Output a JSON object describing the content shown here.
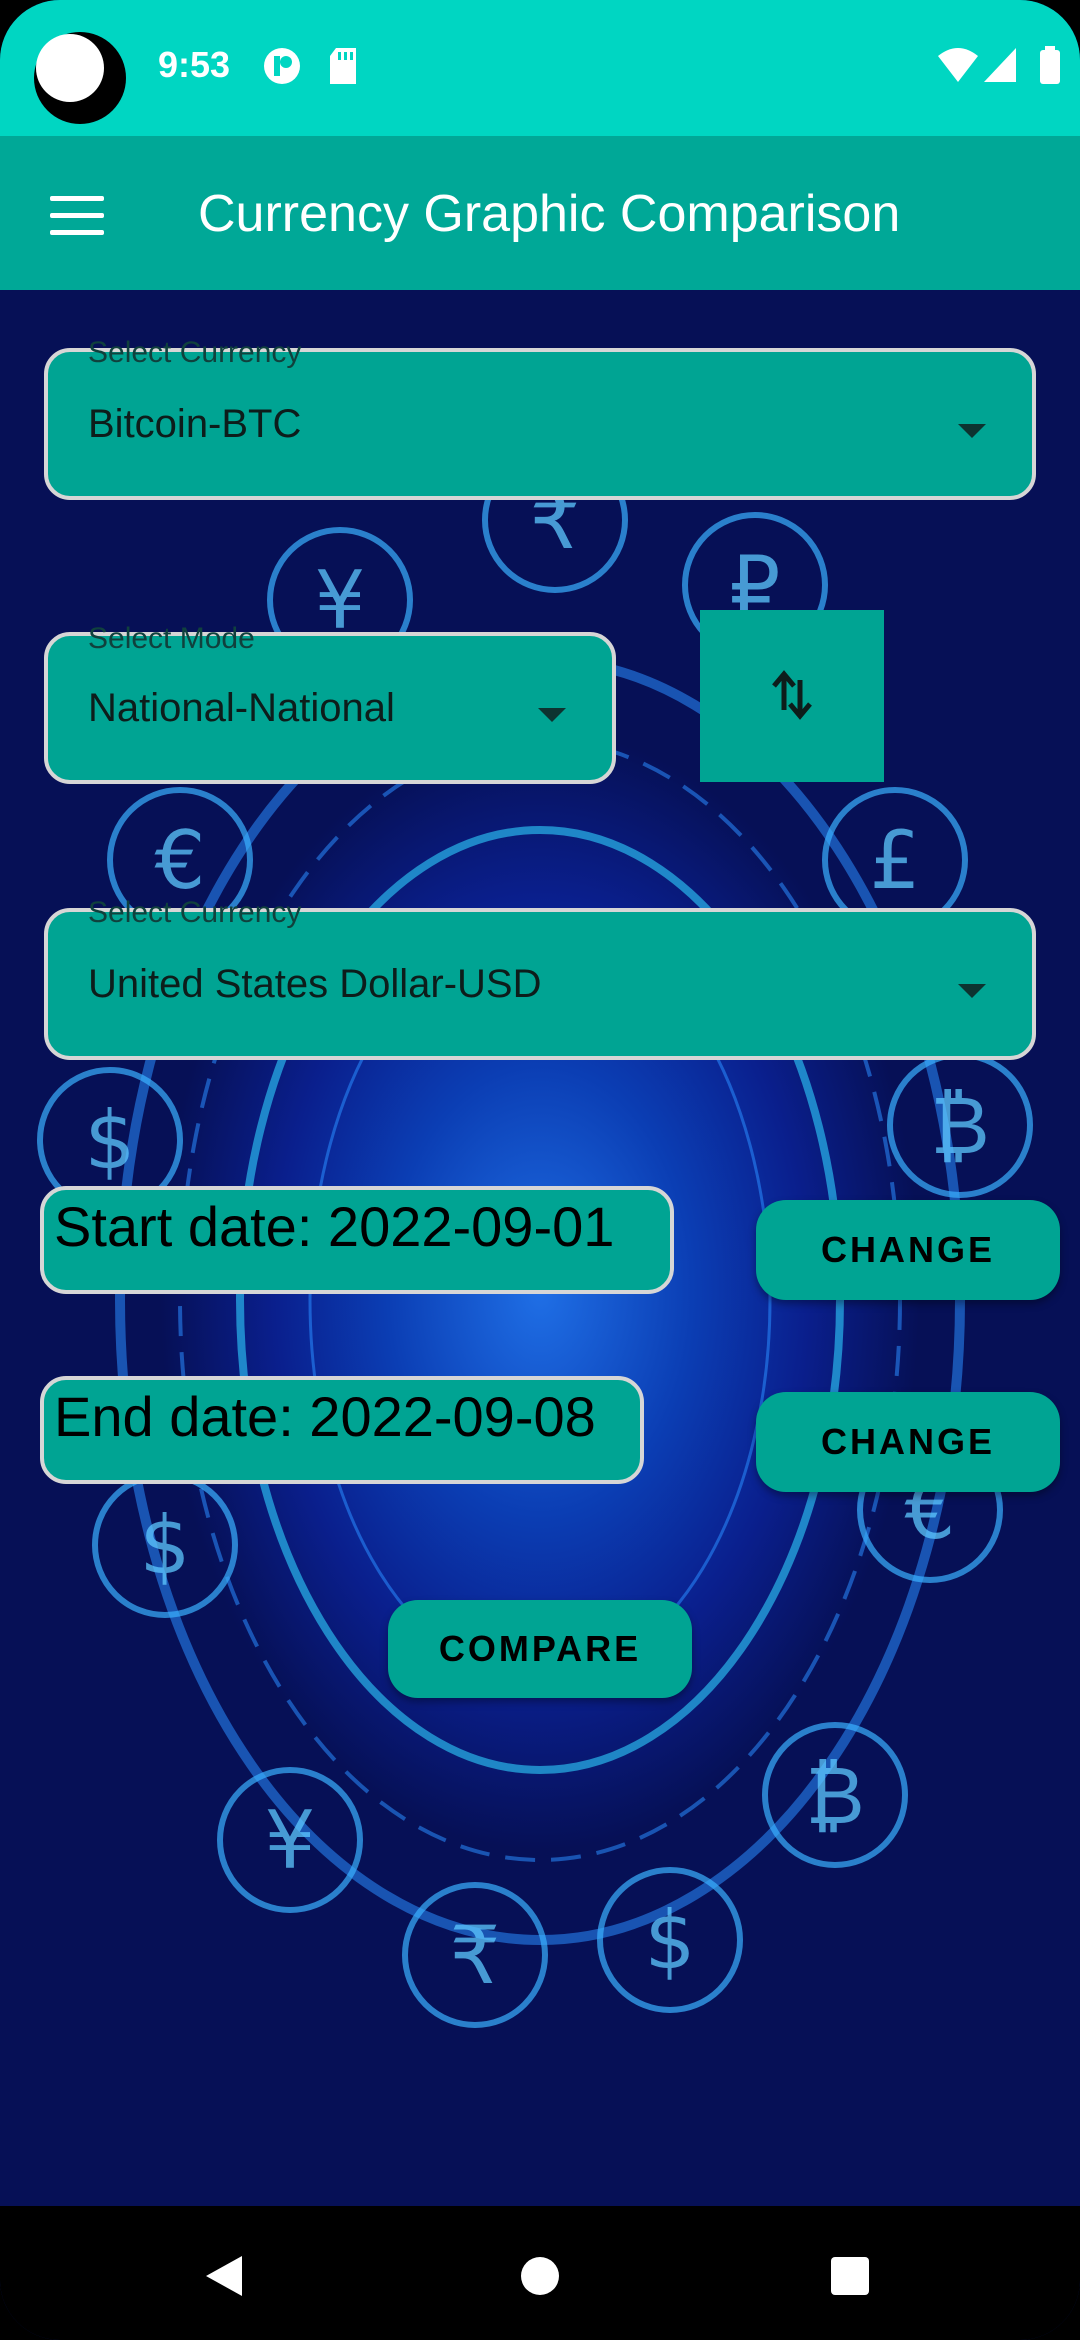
{
  "status_bar": {
    "time": "9:53"
  },
  "app_bar": {
    "title": "Currency Graphic Comparison"
  },
  "form": {
    "currency_from": {
      "label": "Select Currency",
      "value": "Bitcoin-BTC"
    },
    "mode": {
      "label": "Select Mode",
      "value": "National-National"
    },
    "currency_to": {
      "label": "Select Currency",
      "value": "United States Dollar-USD"
    },
    "start_date": {
      "text": "Start date: 2022-09-01",
      "button": "CHANGE"
    },
    "end_date": {
      "text": "End date: 2022-09-08",
      "button": "CHANGE"
    },
    "compare_button": "COMPARE"
  },
  "colors": {
    "status_bar": "#00d6c2",
    "app_bar": "#00a897",
    "field": "#00a493"
  },
  "icons": [
    "menu-icon",
    "swap-vertical-icon",
    "dropdown-arrow-icon",
    "wifi-icon",
    "signal-icon",
    "battery-icon",
    "back-icon",
    "home-icon",
    "recents-icon"
  ]
}
